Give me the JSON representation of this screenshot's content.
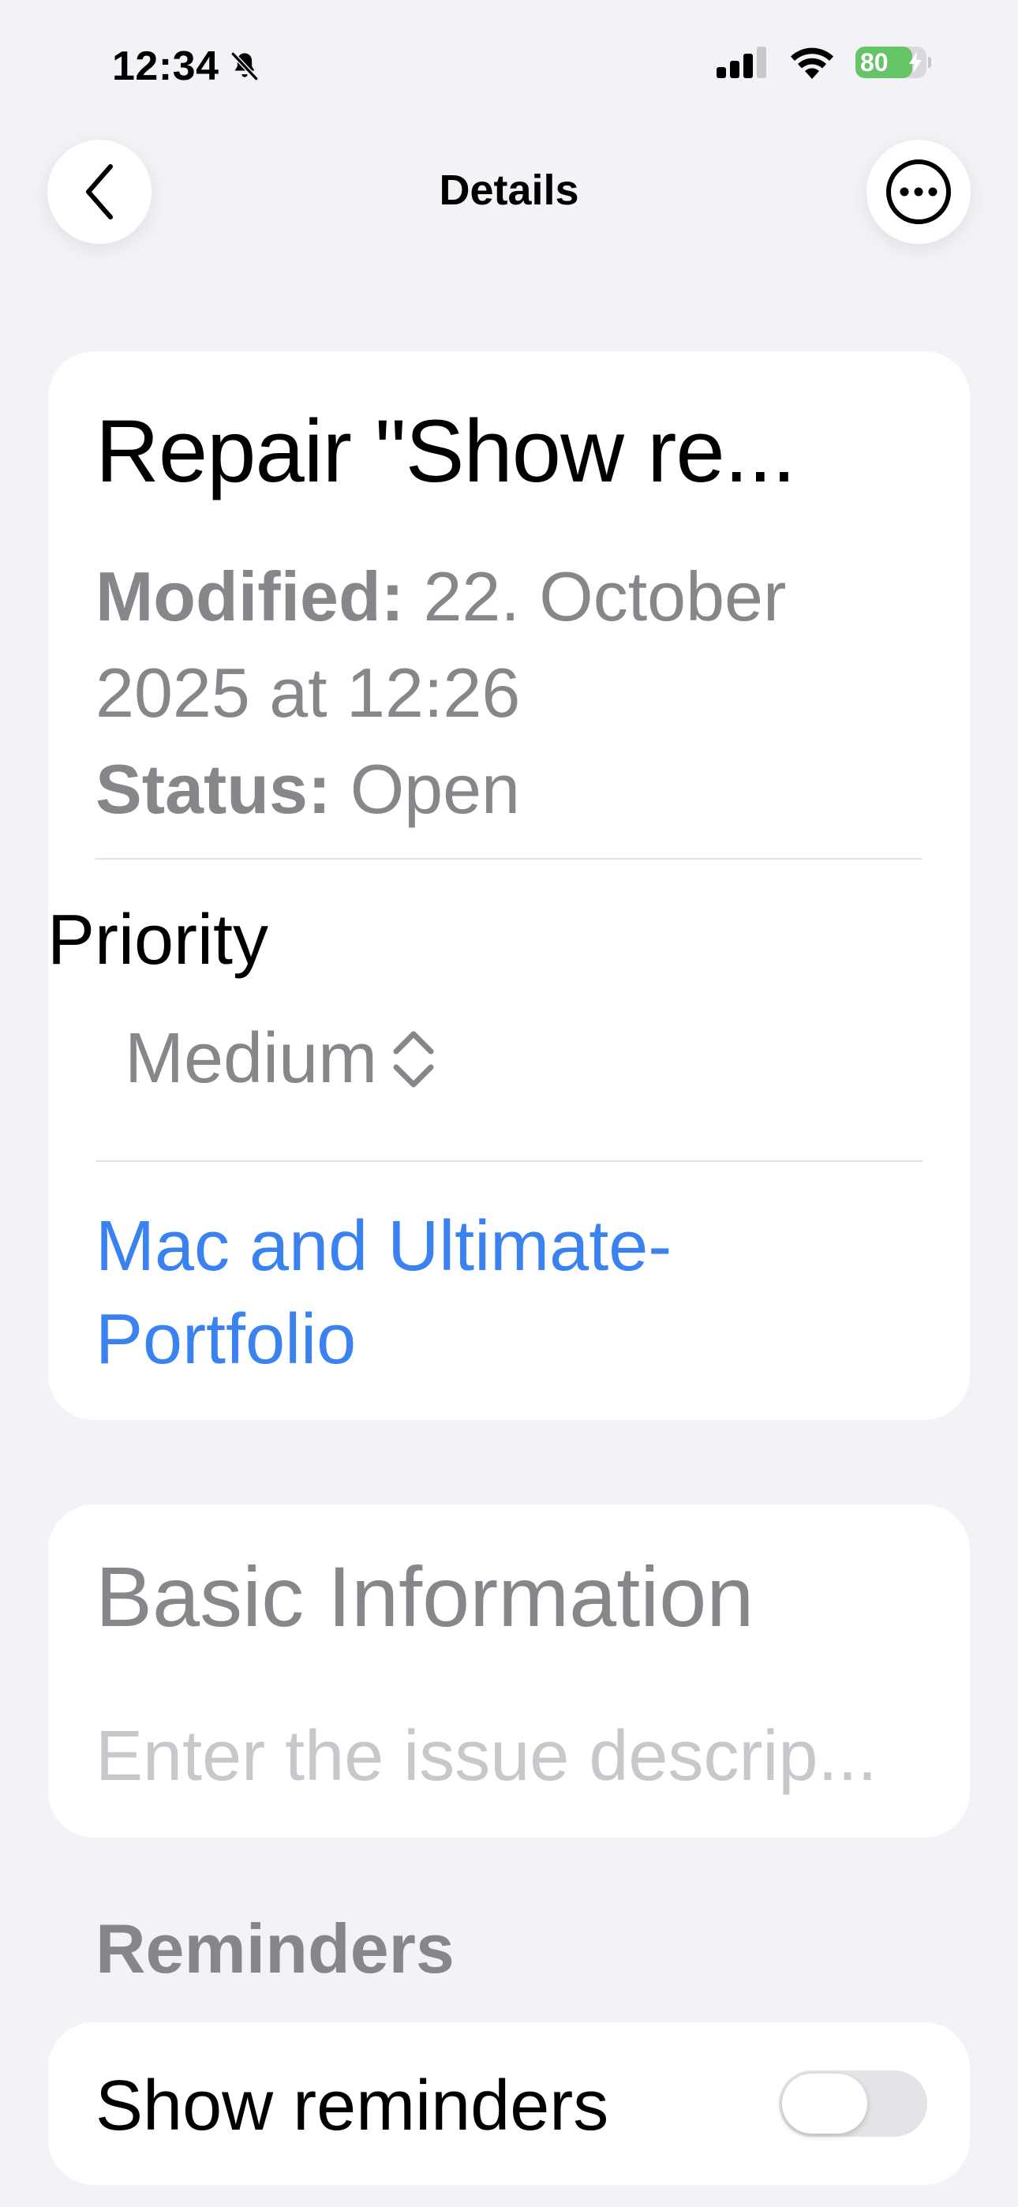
{
  "status_bar": {
    "time": "12:34",
    "battery_level": "80",
    "battery_fraction": 0.8,
    "bell_icon": "bell-slash-icon",
    "signal_icon": "cellular-signal-icon",
    "wifi_icon": "wifi-icon",
    "battery_color": "#65c466"
  },
  "nav": {
    "title": "Details",
    "back_icon": "chevron-left-icon",
    "more_icon": "ellipsis-circle-icon"
  },
  "details": {
    "title": "Repair \"Show re...",
    "modified_label": "Modified:",
    "modified_value": "22. October 2025 at 12:26",
    "status_label": "Status:",
    "status_value": "Open",
    "priority_label": "Priority",
    "priority_value": "Medium",
    "priority_icon": "chevron-up-down-icon",
    "portfolio_link": "Mac and Ultimate-Portfolio",
    "link_color": "#3a82f0"
  },
  "basic_info": {
    "title": "Basic Information",
    "placeholder": "Enter the issue descrip...",
    "value": ""
  },
  "reminders": {
    "header": "Reminders",
    "show_label": "Show reminders",
    "show_enabled": false
  }
}
